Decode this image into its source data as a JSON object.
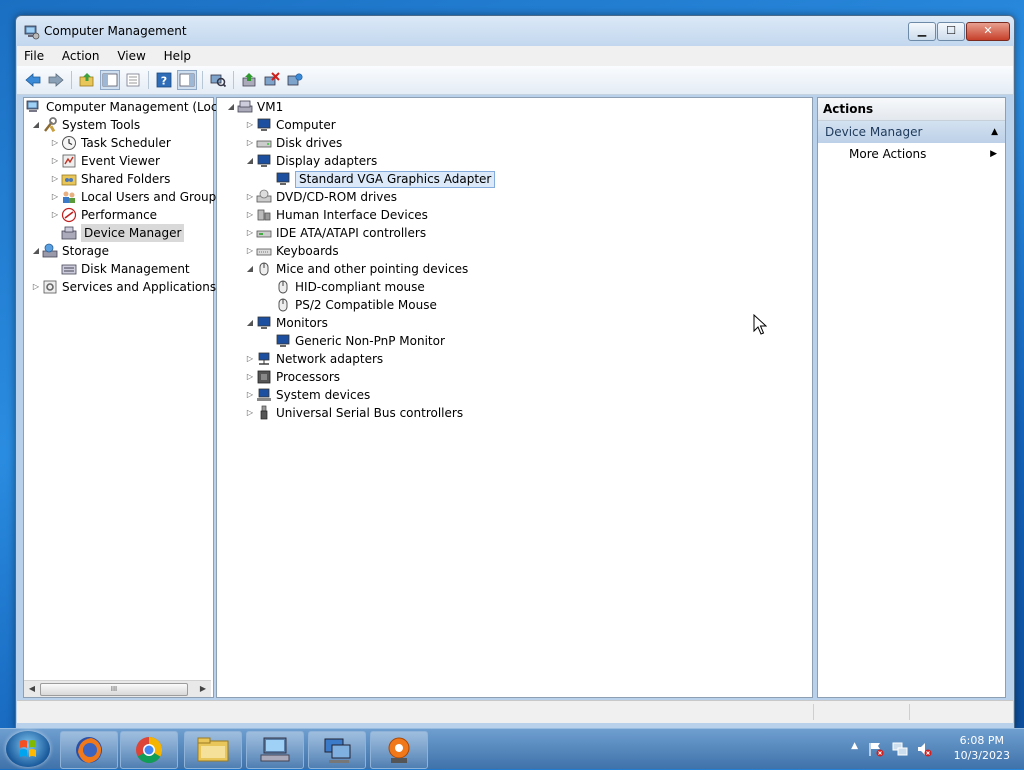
{
  "window": {
    "title": "Computer Management",
    "min_symbol": "▁",
    "max_symbol": "☐",
    "close_symbol": "✕"
  },
  "menu": [
    "File",
    "Action",
    "View",
    "Help"
  ],
  "toolbar": {
    "icons": [
      "back-arrow-icon",
      "forward-arrow-icon",
      "up-folder-icon",
      "show-hide-console-tree-icon",
      "properties-icon",
      "help-icon",
      "show-action-pane-icon",
      "scan-hardware-icon",
      "update-driver-icon",
      "disable-device-icon",
      "uninstall-device-icon"
    ]
  },
  "left_tree": {
    "root": "Computer Management (Local",
    "system_tools": "System Tools",
    "task_scheduler": "Task Scheduler",
    "event_viewer": "Event Viewer",
    "shared_folders": "Shared Folders",
    "local_users": "Local Users and Groups",
    "performance": "Performance",
    "device_manager": "Device Manager",
    "storage": "Storage",
    "disk_management": "Disk Management",
    "services": "Services and Applications",
    "scroll_grip": "III"
  },
  "device_tree": {
    "root": "VM1",
    "computer": "Computer",
    "disk_drives": "Disk drives",
    "display_adapters": "Display adapters",
    "vga": "Standard VGA Graphics Adapter",
    "dvd": "DVD/CD-ROM drives",
    "hid": "Human Interface Devices",
    "ide": "IDE ATA/ATAPI controllers",
    "keyboards": "Keyboards",
    "mice": "Mice and other pointing devices",
    "hid_mouse": "HID-compliant mouse",
    "ps2_mouse": "PS/2 Compatible Mouse",
    "monitors": "Monitors",
    "generic_monitor": "Generic Non-PnP Monitor",
    "network": "Network adapters",
    "processors": "Processors",
    "system_devices": "System devices",
    "usb": "Universal Serial Bus controllers"
  },
  "actions": {
    "header": "Actions",
    "section": "Device Manager",
    "more": "More Actions"
  },
  "taskbar": {
    "apps": [
      "firefox-icon",
      "chrome-icon",
      "file-explorer-icon",
      "computer-management-icon",
      "network-icon",
      "media-app-icon"
    ],
    "time": "6:08 PM",
    "date": "10/3/2023",
    "tray_arrow": "▲"
  },
  "colors": {
    "selection_blue": "#dbe9f8",
    "accent": "#1462b8"
  }
}
